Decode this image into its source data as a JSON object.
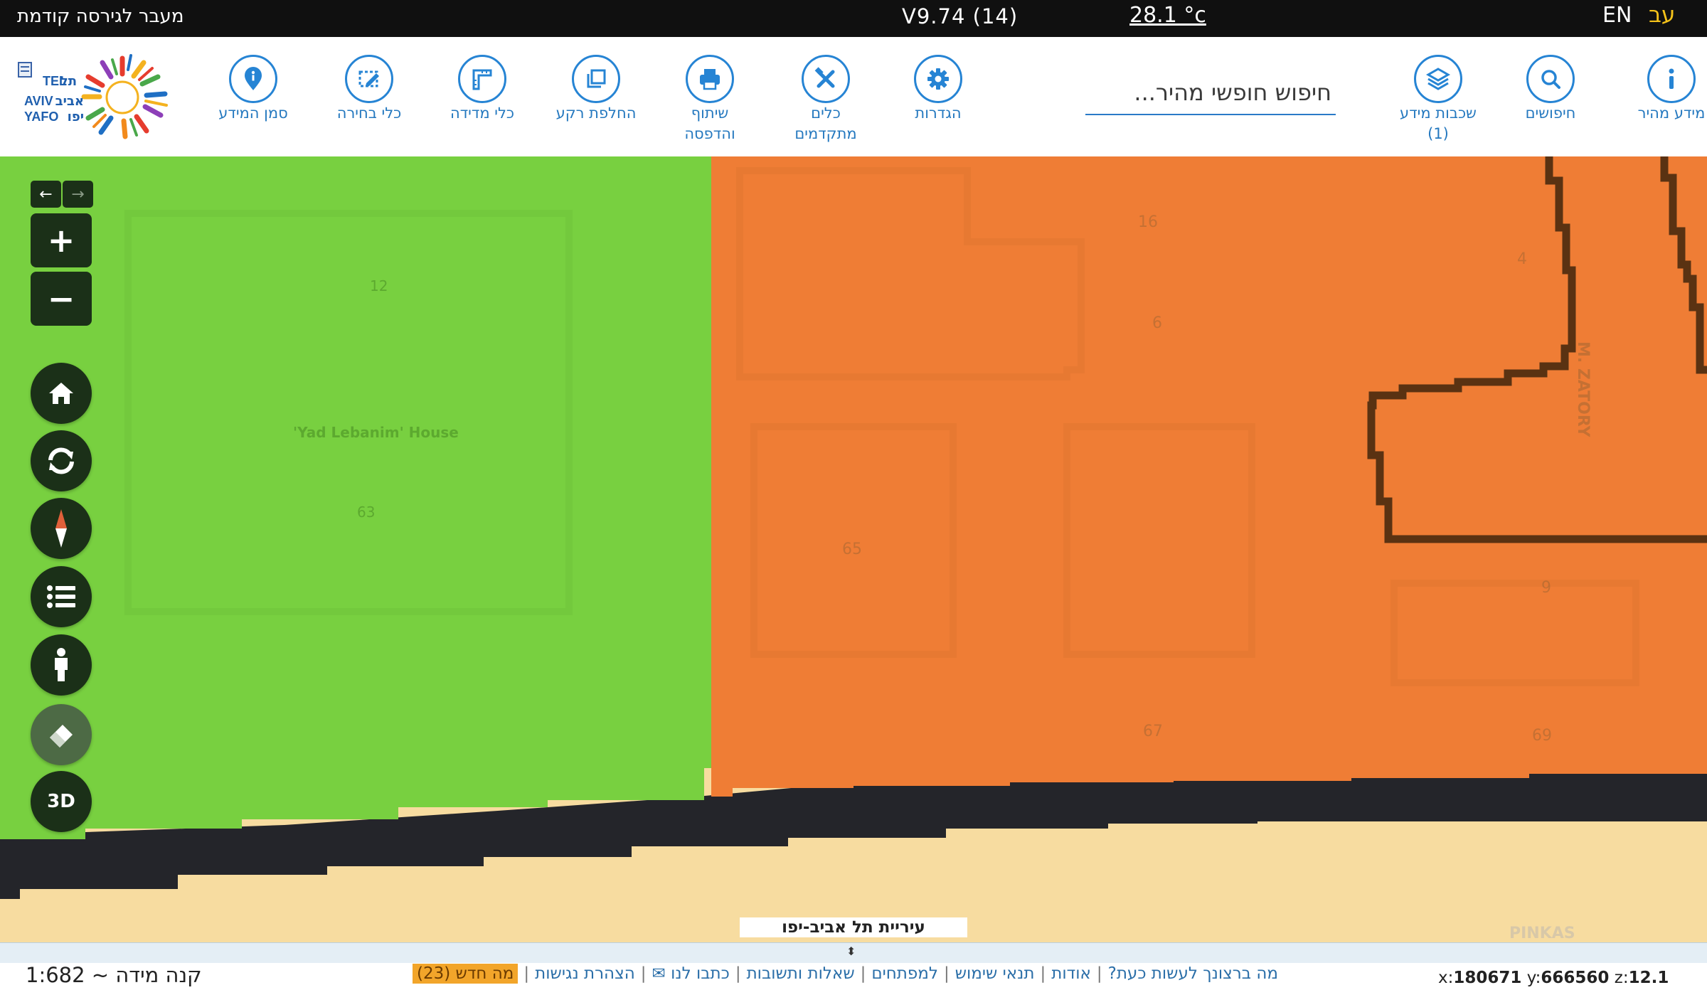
{
  "topbar": {
    "prev_version": "מעבר לגירסה קודמת",
    "version": "V9.74 (14)",
    "temperature": "28.1 °c",
    "lang_en": "EN",
    "lang_he": "עב"
  },
  "toolbar": {
    "tools": [
      {
        "id": "quick-info",
        "label": "מידע מהיר",
        "icon": "info-icon"
      },
      {
        "id": "searches",
        "label": "חיפושים",
        "icon": "search-icon"
      },
      {
        "id": "info-layers",
        "label": "שכבות מידע\n(1)",
        "icon": "layers-icon"
      },
      {
        "id": "settings",
        "label": "הגדרות",
        "icon": "gear-icon"
      },
      {
        "id": "advanced-tools",
        "label": "כלים\nמתקדמים",
        "icon": "tools-icon"
      },
      {
        "id": "share-print",
        "label": "שיתוף\nוהדפסה",
        "icon": "print-icon"
      },
      {
        "id": "switch-background",
        "label": "החלפת רקע",
        "icon": "background-icon"
      },
      {
        "id": "measure-tools",
        "label": "כלי מדידה",
        "icon": "ruler-icon"
      },
      {
        "id": "selection-tools",
        "label": "כלי בחירה",
        "icon": "select-icon"
      },
      {
        "id": "info-marker",
        "label": "סמן המידע",
        "icon": "marker-icon"
      }
    ],
    "search_placeholder": "חיפוש חופשי מהיר...",
    "logo_text": "תל אביב יפו TEL AVIV YAFO"
  },
  "map": {
    "labels": [
      {
        "text": "12"
      },
      {
        "text": "'Yad Lebanim' House"
      },
      {
        "text": "63"
      },
      {
        "text": "16"
      },
      {
        "text": "6"
      },
      {
        "text": "65"
      },
      {
        "text": "67"
      },
      {
        "text": "4"
      },
      {
        "text": "M. ZATORY"
      },
      {
        "text": "9"
      },
      {
        "text": "69"
      },
      {
        "text": "PINKAS"
      }
    ],
    "city_label": "עיריית תל אביב-יפו",
    "colors": {
      "green": "#78d040",
      "orange": "#ef7d35",
      "road": "#24252a",
      "sand": "#f7dca0"
    }
  },
  "controls": {
    "back_arrow": "←",
    "forward_arrow": "→",
    "zoom_in": "+",
    "zoom_out": "−",
    "three_d": "3D"
  },
  "statusbar": {
    "scale": "קנה מידה ~ 1:682",
    "links": [
      "מה ברצונך לעשות כעת?",
      "אודות",
      "תנאי שימוש",
      "למפתחים",
      "שאלות ותשובות",
      "כתבו לנו ✉",
      "הצהרת נגישות"
    ],
    "whats_new": "מה חדש (23)",
    "coords": {
      "x_label": "x:",
      "x": "180671",
      "y_label": "y:",
      "y": "666560",
      "z_label": "z:",
      "z": "12.1"
    }
  }
}
